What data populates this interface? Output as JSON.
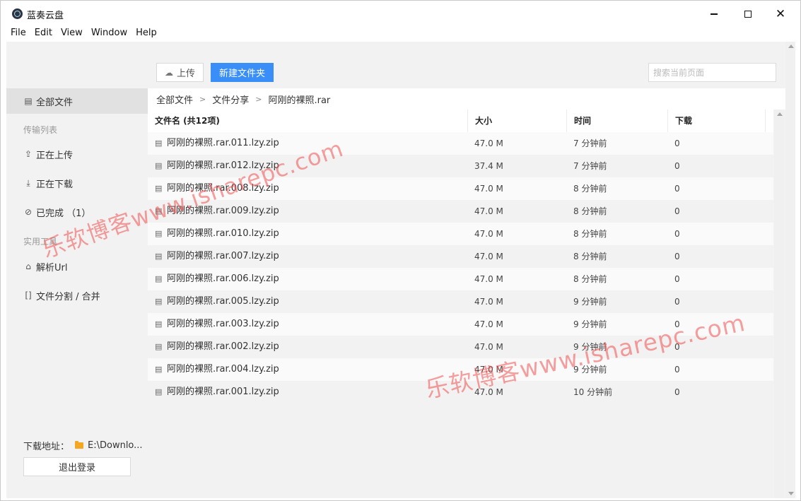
{
  "app": {
    "title": "蓝奏云盘"
  },
  "window_controls": {
    "minimize": "—",
    "maximize": "□",
    "close": "✕"
  },
  "menu": [
    "File",
    "Edit",
    "View",
    "Window",
    "Help"
  ],
  "sidebar": {
    "all_files": {
      "label": "全部文件",
      "icon": "file-icon"
    },
    "transfer_section": "传输列表",
    "uploading": {
      "label": "正在上传",
      "icon": "upload-icon"
    },
    "downloading": {
      "label": "正在下载",
      "icon": "download-icon"
    },
    "completed": {
      "label": "已完成 （1）",
      "icon": "check-circle-icon"
    },
    "tools_section": "实用工具",
    "parse_url": {
      "label": "解析Url",
      "icon": "link-icon"
    },
    "split_merge": {
      "label": "文件分割 / 合并",
      "icon": "split-icon"
    },
    "download_path_label": "下载地址：",
    "download_path_value": "E:\\Downlo...",
    "logout": "退出登录"
  },
  "toolbar": {
    "upload_label": "上传",
    "new_folder_label": "新建文件夹",
    "search_placeholder": "搜索当前页面"
  },
  "breadcrumb": [
    "全部文件",
    "文件分享",
    "阿刚的裸照.rar"
  ],
  "breadcrumb_separator": ">",
  "table": {
    "headers": {
      "name": "文件名 (共12项)",
      "size": "大小",
      "time": "时间",
      "downloads": "下载"
    },
    "rows": [
      {
        "name": "阿刚的裸照.rar.011.lzy.zip",
        "size": "47.0 M",
        "time": "7 分钟前",
        "downloads": "0"
      },
      {
        "name": "阿刚的裸照.rar.012.lzy.zip",
        "size": "37.4 M",
        "time": "7 分钟前",
        "downloads": "0"
      },
      {
        "name": "阿刚的裸照.rar.008.lzy.zip",
        "size": "47.0 M",
        "time": "8 分钟前",
        "downloads": "0"
      },
      {
        "name": "阿刚的裸照.rar.009.lzy.zip",
        "size": "47.0 M",
        "time": "8 分钟前",
        "downloads": "0"
      },
      {
        "name": "阿刚的裸照.rar.010.lzy.zip",
        "size": "47.0 M",
        "time": "8 分钟前",
        "downloads": "0"
      },
      {
        "name": "阿刚的裸照.rar.007.lzy.zip",
        "size": "47.0 M",
        "time": "8 分钟前",
        "downloads": "0"
      },
      {
        "name": "阿刚的裸照.rar.006.lzy.zip",
        "size": "47.0 M",
        "time": "8 分钟前",
        "downloads": "0"
      },
      {
        "name": "阿刚的裸照.rar.005.lzy.zip",
        "size": "47.0 M",
        "time": "9 分钟前",
        "downloads": "0"
      },
      {
        "name": "阿刚的裸照.rar.003.lzy.zip",
        "size": "47.0 M",
        "time": "9 分钟前",
        "downloads": "0"
      },
      {
        "name": "阿刚的裸照.rar.002.lzy.zip",
        "size": "47.0 M",
        "time": "9 分钟前",
        "downloads": "0"
      },
      {
        "name": "阿刚的裸照.rar.004.lzy.zip",
        "size": "47.0 M",
        "time": "9 分钟前",
        "downloads": "0"
      },
      {
        "name": "阿刚的裸照.rar.001.lzy.zip",
        "size": "47.0 M",
        "time": "10 分钟前",
        "downloads": "0"
      }
    ]
  },
  "watermark": "乐软博客www.isharepc.com",
  "colors": {
    "primary_button": "#3a8ef7",
    "sidebar_bg": "#f2f2f2",
    "active_item_bg": "#e1e1e1",
    "watermark": "#f05050",
    "folder": "#f5a623"
  }
}
